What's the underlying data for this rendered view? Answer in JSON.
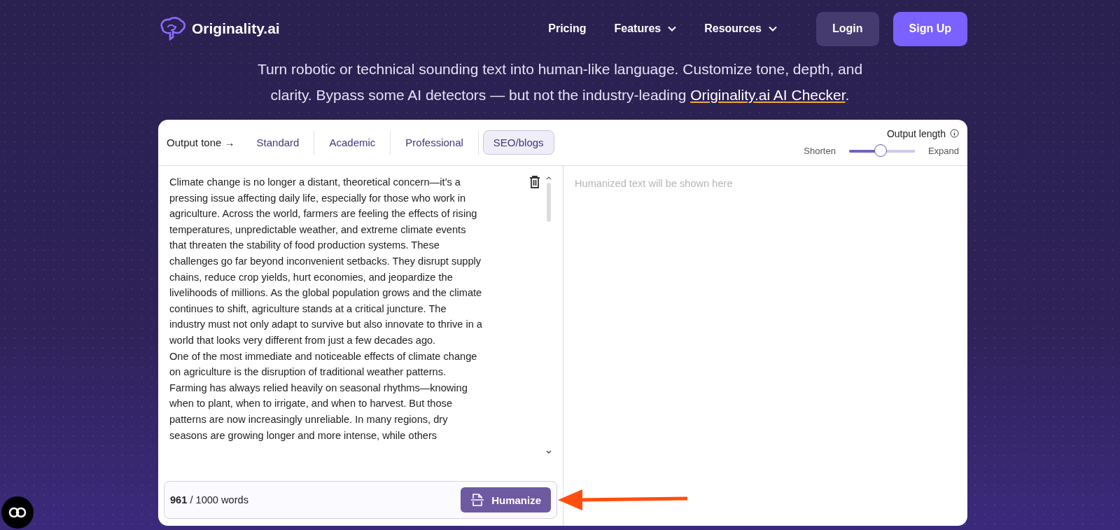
{
  "nav": {
    "logo_text": "Originality.ai",
    "links": [
      {
        "label": "Pricing",
        "dropdown": false
      },
      {
        "label": "Features",
        "dropdown": true
      },
      {
        "label": "Resources",
        "dropdown": true
      }
    ],
    "buttons": [
      {
        "label": "Login",
        "kind": "secondary"
      },
      {
        "label": "Sign Up",
        "kind": "primary"
      }
    ]
  },
  "subtitle": {
    "text_before": "Turn robotic or technical sounding text into human-like language. Customize tone, depth, and clarity. Bypass some AI detectors — but not the industry-leading ",
    "link": "Originality.ai AI Checker",
    "text_after": "."
  },
  "tone": {
    "label": "Output tone →",
    "tabs": [
      {
        "label": "Standard",
        "selected": false
      },
      {
        "label": "Academic",
        "selected": false
      },
      {
        "label": "Professional",
        "selected": false
      },
      {
        "label": "SEO/blogs",
        "selected": true
      }
    ]
  },
  "output_length": {
    "label": "Output length",
    "min_label": "Shorten",
    "max_label": "Expand",
    "level": 0.48
  },
  "input": {
    "paragraphs": [
      "Climate change is no longer a distant, theoretical concern—it’s a pressing issue affecting daily life, especially for those who work in agriculture. Across the world, farmers are feeling the effects of rising temperatures, unpredictable weather, and extreme climate events that threaten the stability of food production systems. These challenges go far beyond inconvenient setbacks. They disrupt supply chains, reduce crop yields, hurt economies, and jeopardize the livelihoods of millions. As the global population grows and the climate continues to shift, agriculture stands at a critical juncture. The industry must not only adapt to survive but also innovate to thrive in a world that looks very different from just a few decades ago.",
      "One of the most immediate and noticeable effects of climate change on agriculture is the disruption of traditional weather patterns. Farming has always relied heavily on seasonal rhythms—knowing when to plant, when to irrigate, and when to harvest. But those patterns are now increasingly unreliable. In many regions, dry seasons are growing longer and more intense, while others"
    ],
    "word_count": "**961** / 1000 words",
    "button": "Humanize"
  },
  "output": {
    "placeholder": "Humanized text will be shown here"
  }
}
